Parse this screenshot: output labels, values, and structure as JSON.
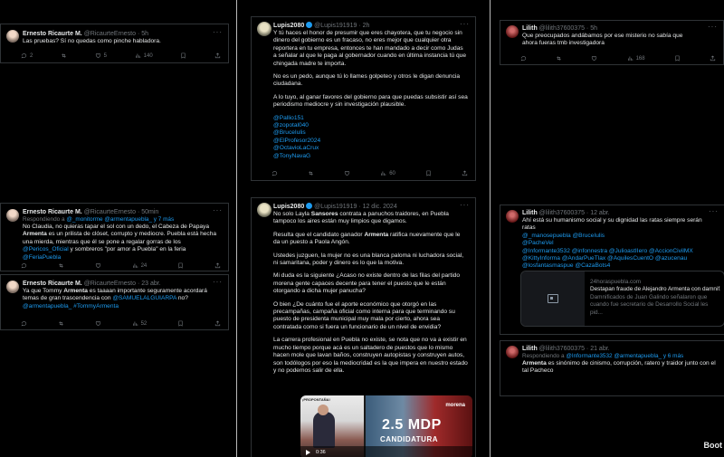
{
  "icons": {
    "reply": "reply-icon",
    "repost": "repost-icon",
    "like": "heart-icon",
    "views": "views-icon",
    "bookmark": "bookmark-icon",
    "share": "share-icon",
    "more": "more-icon",
    "verified": "verified-badge-icon",
    "play": "play-icon",
    "article": "article-icon"
  },
  "colors": {
    "accent": "#1d9bf0",
    "muted": "#71767b",
    "text": "#e7e9ea",
    "bg": "#000000"
  },
  "more_label": "···",
  "watermark": "Boot",
  "tweets": {
    "t1": {
      "name": "Ernesto Ricaurte M.",
      "handle": "@RicaurteErnesto · 5h",
      "text": "Las pruebas? Sí no quedas como pinche habladora.",
      "replies": "2",
      "reposts": "",
      "likes": "5",
      "views": "140"
    },
    "t2": {
      "name": "Ernesto Ricaurte M.",
      "handle": "@RicaurteErnesto · 50min",
      "replying_label": "Respondiendo a",
      "replying_to": "@_monitorme @armentapuebla_ y 7 más",
      "text_a": "No Claudia, no quieras tapar el sol con un dedo, el Cabeza de Papaya ",
      "text_bold": "Armenta",
      "text_b": " es un prilista de clóset, corrupto y mediocre. Puebla está hecha una mierda, mientras que él se pone a regalar gorras de los ",
      "text_link": "@Pericos_Oficial",
      "text_c": " y sombreros \"por amor a Puebla\" en la feria ",
      "text_link2": "@FeriaPuebla",
      "replies": "",
      "reposts": "",
      "likes": "",
      "views": "24"
    },
    "t3": {
      "name": "Ernesto Ricaurte M.",
      "handle": "@RicaurteErnesto · 23 abr.",
      "text_a": "Ya que Tommy ",
      "text_bold": "Armenta",
      "text_b": " es taaaan importante seguramente acordará temas de gran trascendencia con ",
      "text_link": "@SAMUELALGUIARPA",
      "text_c": " no?",
      "text_link2": "@armentapuebla_ #TommyArmenta",
      "replies": "",
      "reposts": "",
      "likes": "",
      "views": "52"
    },
    "t4": {
      "name": "Lupis2080",
      "handle": "@Lupis191919 · 2h",
      "p1": "Y tú haces el honor de presumir que eres chayotera, que tu negocio sin dinero del gobierno es un fracaso, no eres mejor que cualquier otra reportera en tu empresa, entonces te han mandado a decir como Judas a señalar al que le paga al gobernador cuando en última instancia tú que chingada madre te importa.",
      "p2": "No es un pedo, aunque tú lo llames golpeteo y otros le digan denuncia ciudadana.",
      "p3": "A lo tuyo, al ganar favores del gobierno para que puedas subsistir así sea periodismo mediocre y sin investigación plausible.",
      "mentions": [
        "@Pallio151",
        "@zopotal040",
        "@BruceIulis",
        "@ElProfesor2024",
        "@OctavioLaCrux",
        "@TonyNavaG"
      ],
      "replies": "",
      "reposts": "",
      "likes": "",
      "views": "60"
    },
    "t5": {
      "name": "Lupis2080",
      "handle": "@Lupis191919 · 12 dic. 2024",
      "p1a": "No solo Layla ",
      "p1b": "Sansores",
      "p1c": " contrata a panuchos traidores, en Puebla tampoco los aires están muy limpios que digamos.",
      "p2a": "Resulta que el candidato ganador ",
      "p2b": "Armenta",
      "p2c": " ratifica nuevamente que le da un puesto a Paola Angón.",
      "p3": "Ustedes juzguen, la mujer no es una blanca paloma ni luchadora social, ni samaritana, poder y dinero es lo que la motiva.",
      "p4": "Mi duda es la siguiente ¿Acaso no existe dentro de las filas del partido morena gente capaces decente para tener el puesto que le están otorgando a dicha mujer panucha?",
      "p5": "O bien ¿De cuánto fue el aporte económico que otorgó en las precampañas, campaña oficial como interna para que terminando su puesto de presidenta municipal muy mala por cierto, ahora sea contratada como si fuera un funcionario de un nivel de envidia?",
      "p6": "La carrera profesional en Puebla no existe, se nota que no va a existir en mucho tiempo porque acá es un saltadero de puestos que lo mismo hacen mole que lavan baños, construyen autopistas y construyen autos, son todólogos por eso la mediocridad es la que impera en nuestro estado y no podemos salir de ella.",
      "media_top_label": "¡PROPONTAÑA!",
      "media_overlay": "2.5 MDP",
      "media_overlay2": "CANDIDATURA",
      "media_logo": "morena",
      "media_time": "0:36"
    },
    "t6": {
      "name": "Lilith",
      "handle": "@lilith37600375 · 5h",
      "text": "Que preocupados andábamos por ese misterio no sabía que ahora fueras tmb investigadora",
      "replies": "",
      "reposts": "",
      "likes": "",
      "views": "168"
    },
    "t7": {
      "name": "Lilith",
      "handle": "@lilith37600375 · 12 abr.",
      "text": "Ahí está su humanismo social y su dignidad las ratas siempre serán ratas",
      "mentions_line1": "@_manosepuebla @BruceIulis",
      "mentions_line2": "@PacheVel",
      "mentions_line3": "@Informante3532 @infonnestra @JulioastIIero @AccionCivilMX",
      "mentions_line4": "@KittyInforma @AndarPueTlax @AquilesCuentO @azucenau",
      "mentions_line5": "@losfantasmaspue @CazaBots4",
      "card_domain": "24horaspuebla.com",
      "card_title": "Destapan fraude de Alejandro Armenta con damnif...",
      "card_desc": "Damnificados de Juan Galindo señalaron que cuando fue secretario de Desarrollo Social les pid..."
    },
    "t8": {
      "name": "Lilith",
      "handle": "@lilith37600375 · 21 abr.",
      "replying_label": "Respondiendo a",
      "replying_to": "@Informante3532 @armentapuebla_ y 6 más",
      "text_bold": "Armenta",
      "text_b": " es sinónimo de cinismo, corrupción, ratero  y traidor junto con el tal Pacheco"
    }
  }
}
